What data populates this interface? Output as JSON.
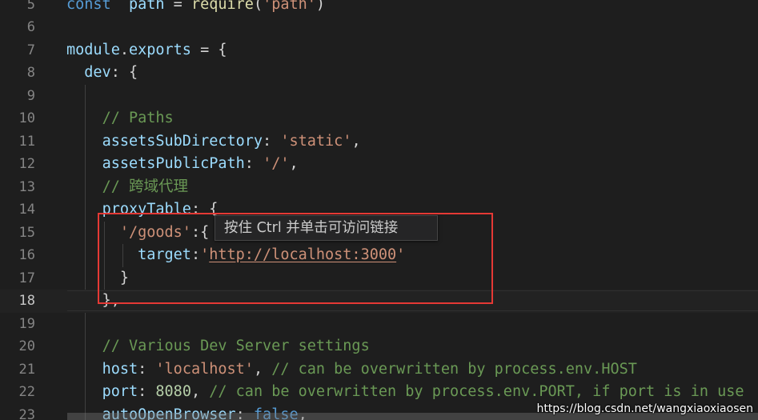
{
  "colors": {
    "background": "#1e1e1e",
    "keyword": "#569cd6",
    "function": "#dcdcaa",
    "property": "#9cdcfe",
    "string": "#ce9178",
    "comment": "#6a9955",
    "number": "#b5cea8",
    "annotation_box": "#e53935"
  },
  "active_line": 18,
  "lines": [
    {
      "n": "5",
      "t": [
        [
          "kw",
          "const"
        ],
        [
          "",
          "  "
        ],
        [
          "var",
          "path"
        ],
        [
          "",
          " = "
        ],
        [
          "fn",
          "require"
        ],
        [
          "",
          "("
        ],
        [
          "str",
          "'path'"
        ],
        [
          "",
          ")"
        ]
      ]
    },
    {
      "n": "6",
      "t": []
    },
    {
      "n": "7",
      "t": [
        [
          "var",
          "module"
        ],
        [
          "",
          "."
        ],
        [
          "var",
          "exports"
        ],
        [
          "",
          " = {"
        ]
      ]
    },
    {
      "n": "8",
      "t": [
        [
          "",
          "  "
        ],
        [
          "var",
          "dev"
        ],
        [
          "",
          ": {"
        ]
      ]
    },
    {
      "n": "9",
      "t": []
    },
    {
      "n": "10",
      "t": [
        [
          "",
          "    "
        ],
        [
          "cm",
          "// Paths"
        ]
      ]
    },
    {
      "n": "11",
      "t": [
        [
          "",
          "    "
        ],
        [
          "var",
          "assetsSubDirectory"
        ],
        [
          "",
          ": "
        ],
        [
          "str",
          "'static'"
        ],
        [
          "",
          ","
        ]
      ]
    },
    {
      "n": "12",
      "t": [
        [
          "",
          "    "
        ],
        [
          "var",
          "assetsPublicPath"
        ],
        [
          "",
          ": "
        ],
        [
          "str",
          "'/'"
        ],
        [
          "",
          ","
        ]
      ]
    },
    {
      "n": "13",
      "t": [
        [
          "",
          "    "
        ],
        [
          "cm",
          "// 跨域代理"
        ]
      ]
    },
    {
      "n": "14",
      "t": [
        [
          "",
          "    "
        ],
        [
          "var",
          "proxyTable"
        ],
        [
          "",
          ": {"
        ]
      ]
    },
    {
      "n": "15",
      "t": [
        [
          "",
          "      "
        ],
        [
          "str",
          "'/goods'"
        ],
        [
          "",
          ":{"
        ]
      ]
    },
    {
      "n": "16",
      "t": [
        [
          "",
          "        "
        ],
        [
          "var",
          "target"
        ],
        [
          "",
          ":"
        ],
        [
          "str",
          "'"
        ],
        [
          "link",
          "http://localhost:3000"
        ],
        [
          "str",
          "'"
        ]
      ]
    },
    {
      "n": "17",
      "t": [
        [
          "",
          "      }"
        ]
      ]
    },
    {
      "n": "18",
      "t": [
        [
          "",
          "    },"
        ]
      ]
    },
    {
      "n": "19",
      "t": []
    },
    {
      "n": "20",
      "t": [
        [
          "",
          "    "
        ],
        [
          "cm",
          "// Various Dev Server settings"
        ]
      ]
    },
    {
      "n": "21",
      "t": [
        [
          "",
          "    "
        ],
        [
          "var",
          "host"
        ],
        [
          "",
          ": "
        ],
        [
          "str",
          "'localhost'"
        ],
        [
          "",
          ", "
        ],
        [
          "cm",
          "// can be overwritten by process.env.HOST"
        ]
      ]
    },
    {
      "n": "22",
      "t": [
        [
          "",
          "    "
        ],
        [
          "var",
          "port"
        ],
        [
          "",
          ": "
        ],
        [
          "num",
          "8080"
        ],
        [
          "",
          ", "
        ],
        [
          "cm",
          "// can be overwritten by process.env.PORT, if port is in use"
        ]
      ]
    },
    {
      "n": "23",
      "t": [
        [
          "",
          "    "
        ],
        [
          "var",
          "autoOpenBrowser"
        ],
        [
          "",
          ": "
        ],
        [
          "kw",
          "false"
        ],
        [
          "",
          ","
        ]
      ]
    }
  ],
  "tooltip": "按住 Ctrl 并单击可访问链接",
  "watermark": "https://blog.csdn.net/wangxiaoxiaosen"
}
